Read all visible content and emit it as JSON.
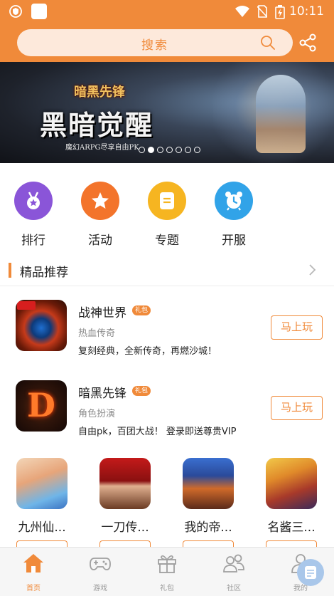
{
  "status_bar": {
    "time": "10:11"
  },
  "header": {
    "search_placeholder": "搜索"
  },
  "banner": {
    "logo_text": "暗黑先锋",
    "title": "黑暗觉醒",
    "subtitle": "魔幻ARPG尽享自由PK",
    "slide_count": 7,
    "active_slide": 1
  },
  "quick_links": [
    {
      "label": "排行",
      "icon": "medal-icon",
      "color": "#8a55d8"
    },
    {
      "label": "活动",
      "icon": "star-icon",
      "color": "#f3742b"
    },
    {
      "label": "专题",
      "icon": "document-icon",
      "color": "#f6b521"
    },
    {
      "label": "开服",
      "icon": "alarm-clock-icon",
      "color": "#31a3e8"
    }
  ],
  "section": {
    "title": "精品推荐"
  },
  "games": [
    {
      "name": "战神世界",
      "badge": "礼包",
      "genre": "热血传奇",
      "desc": "复刻经典，全新传奇，再燃沙城！",
      "button": "马上玩"
    },
    {
      "name": "暗黑先锋",
      "badge": "礼包",
      "genre": "角色扮演",
      "desc": "自由pk，百团大战！ 登录即送尊贵VIP",
      "button": "马上玩"
    }
  ],
  "grid_games": [
    {
      "name": "九州仙..."
    },
    {
      "name": "一刀传..."
    },
    {
      "name": "我的帝..."
    },
    {
      "name": "名酱三..."
    }
  ],
  "tabs": [
    {
      "label": "首页",
      "icon": "home-icon",
      "active": true
    },
    {
      "label": "游戏",
      "icon": "gamepad-icon",
      "active": false
    },
    {
      "label": "礼包",
      "icon": "gift-icon",
      "active": false
    },
    {
      "label": "社区",
      "icon": "community-icon",
      "active": false
    },
    {
      "label": "我的",
      "icon": "profile-icon",
      "active": false
    }
  ],
  "colors": {
    "accent": "#f08a3a",
    "search_bg": "#fde9db"
  }
}
